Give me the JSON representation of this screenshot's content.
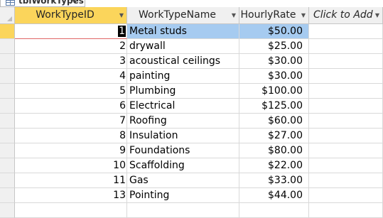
{
  "tab": {
    "title": "tblWorkTypes",
    "close": "×"
  },
  "columns": [
    {
      "label": "WorkTypeID"
    },
    {
      "label": "WorkTypeName"
    },
    {
      "label": "HourlyRate"
    },
    {
      "label": "Click to Add"
    }
  ],
  "rows": [
    {
      "id": "1",
      "name": "Metal studs",
      "rate": "$50.00"
    },
    {
      "id": "2",
      "name": "drywall",
      "rate": "$25.00"
    },
    {
      "id": "3",
      "name": "acoustical ceilings",
      "rate": "$30.00"
    },
    {
      "id": "4",
      "name": "painting",
      "rate": "$30.00"
    },
    {
      "id": "5",
      "name": "Plumbing",
      "rate": "$100.00"
    },
    {
      "id": "6",
      "name": "Electrical",
      "rate": "$125.00"
    },
    {
      "id": "7",
      "name": "Roofing",
      "rate": "$60.00"
    },
    {
      "id": "8",
      "name": "Insulation",
      "rate": "$27.00"
    },
    {
      "id": "9",
      "name": "Foundations",
      "rate": "$80.00"
    },
    {
      "id": "10",
      "name": "Scaffolding",
      "rate": "$22.00"
    },
    {
      "id": "11",
      "name": "Gas",
      "rate": "$33.00"
    },
    {
      "id": "13",
      "name": "Pointing",
      "rate": "$44.00"
    }
  ],
  "colors": {
    "selected_row": "#a6cbf0",
    "active_header": "#fbd55b"
  }
}
